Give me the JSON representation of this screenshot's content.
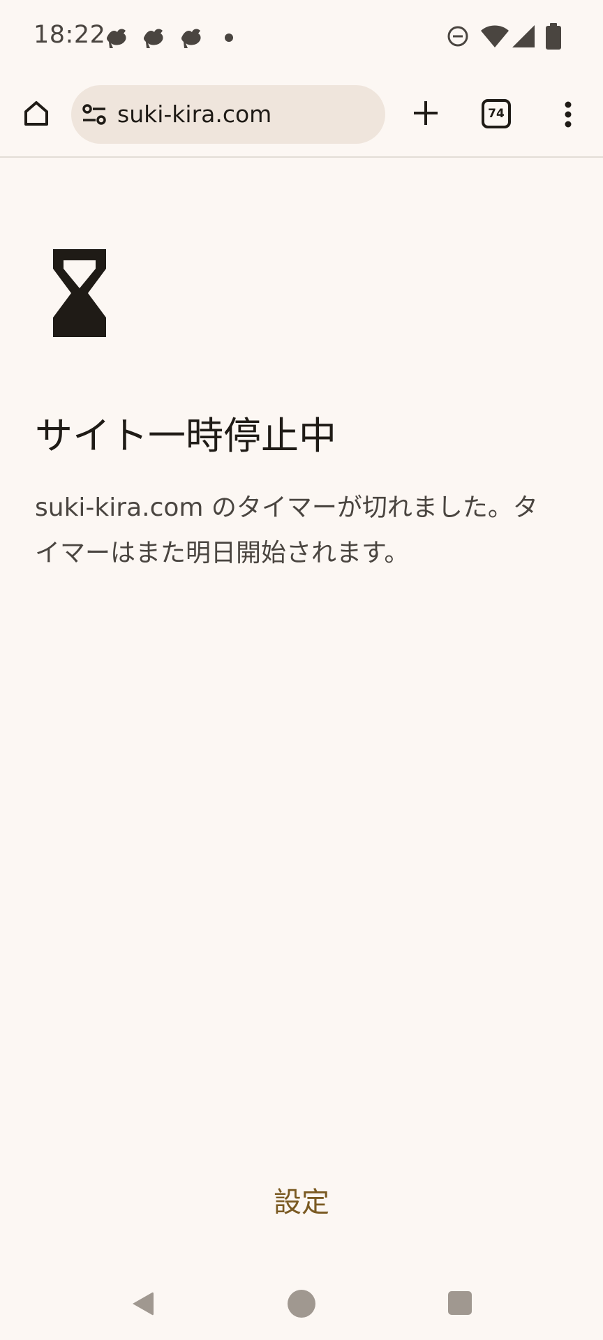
{
  "status_bar": {
    "time": "18:22",
    "notification_icons": [
      "bird-notification-icon",
      "bird-notification-icon",
      "bird-notification-icon",
      "more-notifications-dot"
    ],
    "system_icons": [
      "do-not-disturb-icon",
      "wifi-icon",
      "cellular-signal-icon",
      "battery-icon"
    ]
  },
  "toolbar": {
    "url": "suki-kira.com",
    "tab_count": "74",
    "icons": [
      "home-icon",
      "site-settings-icon",
      "new-tab-icon",
      "tab-switcher-icon",
      "more-menu-icon"
    ]
  },
  "content": {
    "icon": "hourglass-icon",
    "title": "サイト一時停止中",
    "body_line1": "suki-kira.com のタイマーが切れました。タ",
    "body_line2": "イマーはまた明日開始されます。",
    "settings_label": "設定"
  },
  "nav_bar": {
    "icons": [
      "back-icon",
      "home-circle-icon",
      "recents-icon"
    ]
  },
  "colors": {
    "background": "#fcf7f3",
    "url_pill": "#efe5dc",
    "text_primary": "#1f1b16",
    "text_secondary": "#4a4540",
    "link": "#7a5a22"
  }
}
